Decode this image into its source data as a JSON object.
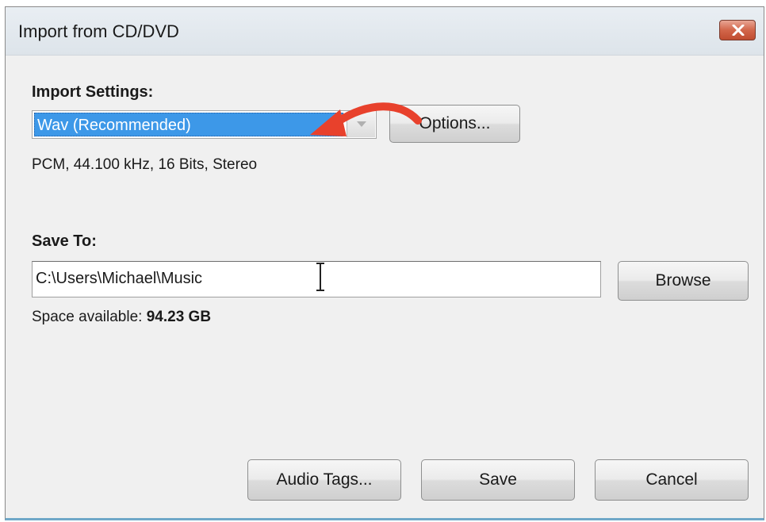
{
  "window": {
    "title": "Import from CD/DVD"
  },
  "import_settings": {
    "label": "Import Settings:",
    "format_selected": "Wav (Recommended)",
    "options_label": "Options...",
    "format_details": "PCM, 44.100 kHz, 16 Bits, Stereo"
  },
  "save_to": {
    "label": "Save To:",
    "path_value": "C:\\Users\\Michael\\Music",
    "browse_label": "Browse",
    "space_label": "Space available:",
    "space_value": "94.23 GB"
  },
  "footer": {
    "audio_tags_label": "Audio Tags...",
    "save_label": "Save",
    "cancel_label": "Cancel"
  },
  "icons": {
    "close": "close-icon",
    "dropdown": "chevron-down-icon",
    "annotation": "curved-arrow-icon",
    "cursor": "text-cursor-icon"
  },
  "colors": {
    "selection": "#3d98e8",
    "arrow": "#e8412c",
    "close_button": "#d2664a"
  }
}
